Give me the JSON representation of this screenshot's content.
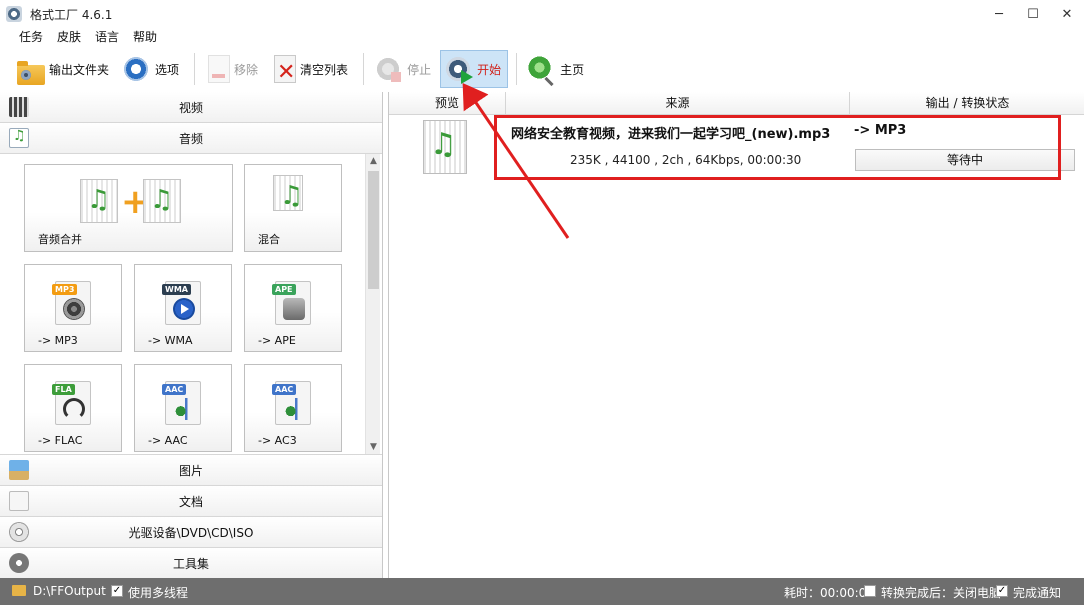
{
  "window": {
    "title": "格式工厂 4.6.1",
    "minimize": "─",
    "maximize": "☐",
    "close": "✕"
  },
  "menu": [
    "任务",
    "皮肤",
    "语言",
    "帮助"
  ],
  "toolbar": {
    "output_folder": "输出文件夹",
    "options": "选项",
    "remove": "移除",
    "clear_list": "清空列表",
    "stop": "停止",
    "start": "开始",
    "home": "主页"
  },
  "categories": {
    "video": "视频",
    "audio": "音频",
    "image": "图片",
    "document": "文档",
    "disc": "光驱设备\\DVD\\CD\\ISO",
    "tools": "工具集"
  },
  "audio_tools": {
    "merge": "音频合并",
    "mix": "混合",
    "formats": [
      {
        "label": "-> MP3",
        "badge": "MP3",
        "badge_color": "#f39c12",
        "glyph": "speaker"
      },
      {
        "label": "-> WMA",
        "badge": "WMA",
        "badge_color": "#2c3e50",
        "glyph": "play"
      },
      {
        "label": "-> APE",
        "badge": "APE",
        "badge_color": "#3aa35b",
        "glyph": "ape"
      },
      {
        "label": "-> FLAC",
        "badge": "FLA",
        "badge_color": "#3d9d3a",
        "glyph": "headset"
      },
      {
        "label": "-> AAC",
        "badge": "AAC",
        "badge_color": "#3f74c9",
        "glyph": "aac"
      },
      {
        "label": "-> AC3",
        "badge": "AAC",
        "badge_color": "#3f74c9",
        "glyph": "aac"
      }
    ]
  },
  "task_list": {
    "columns": [
      "预览",
      "来源",
      "输出 / 转换状态"
    ],
    "rows": [
      {
        "filename": "网络安全教育视频，进来我们一起学习吧_(new).mp3",
        "target": "-> MP3",
        "info": "235K , 44100 , 2ch , 64Kbps, 00:00:30",
        "status": "等待中"
      }
    ]
  },
  "statusbar": {
    "output_path": "D:\\FFOutput",
    "multithread": "使用多线程",
    "elapsed": "耗时：00:00:00",
    "after_done": "转换完成后：关闭电脑",
    "notify": "完成通知"
  },
  "colors": {
    "accent_red": "#e01f1f",
    "statusbar_bg": "#6e6e6e",
    "active_button_bg": "#cde4f7"
  }
}
